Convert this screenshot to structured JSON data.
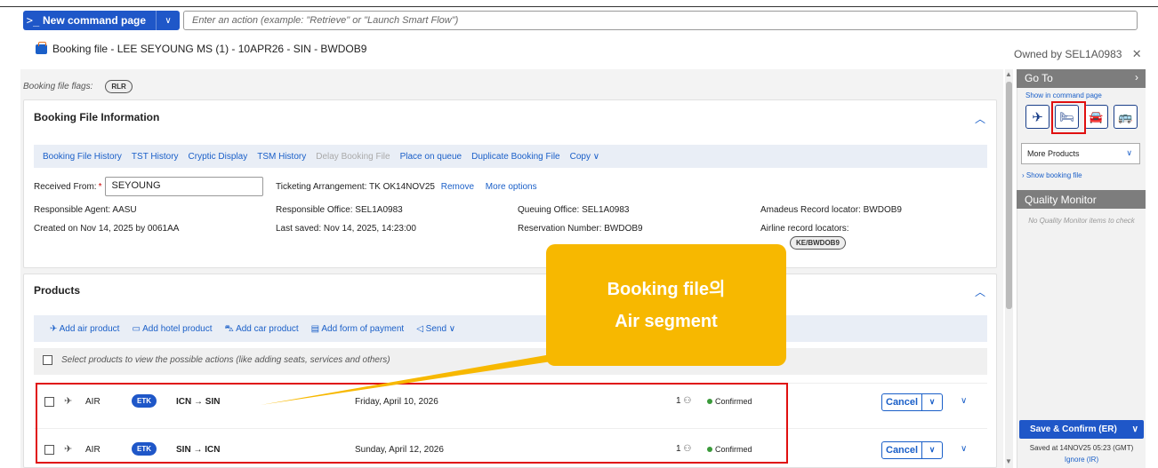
{
  "command_bar": {
    "prompt_glyph": ">_",
    "new_command_label": "New command page",
    "dropdown_glyph": "∨",
    "input_placeholder": "Enter an action (example: \"Retrieve\" or \"Launch Smart Flow\")"
  },
  "header": {
    "title": "Booking file - LEE SEYOUNG MS (1) - 10APR26 - SIN - BWDOB9",
    "owned_by": "Owned by SEL1A0983",
    "close_glyph": "✕"
  },
  "flags": {
    "label": "Booking file flags:",
    "badge": "RLR"
  },
  "booking_info": {
    "title": "Booking File Information",
    "toolbar": [
      {
        "label": "Booking File History",
        "enabled": true
      },
      {
        "label": "TST History",
        "enabled": true
      },
      {
        "label": "Cryptic Display",
        "enabled": true
      },
      {
        "label": "TSM History",
        "enabled": true
      },
      {
        "label": "Delay Booking File",
        "enabled": false
      },
      {
        "label": "Place on queue",
        "enabled": true
      },
      {
        "label": "Duplicate Booking File",
        "enabled": true
      },
      {
        "label": "Copy ∨",
        "enabled": true
      }
    ],
    "received_from_label": "Received From:",
    "received_from_required": "*",
    "received_from_value": "SEYOUNG",
    "ticketing_arrangement": "Ticketing Arrangement: TK OK14NOV25",
    "remove_label": "Remove",
    "more_options_label": "More options",
    "responsible_agent": "Responsible Agent: AASU",
    "responsible_office": "Responsible Office: SEL1A0983",
    "queuing_office": "Queuing Office: SEL1A0983",
    "amadeus_locator": "Amadeus Record locator: BWDOB9",
    "created_on": "Created on Nov 14, 2025 by 0061AA",
    "last_saved": "Last saved: Nov 14, 2025, 14:23:00",
    "reservation_number": "Reservation Number: BWDOB9",
    "airline_locators_label": "Airline record locators:",
    "airline_locator_badge": "KE/BWDOB9"
  },
  "products": {
    "title": "Products",
    "actions": [
      "Add air product",
      "Add hotel product",
      "Add car product",
      "Add form of payment",
      "Send ∨"
    ],
    "select_hint": "Select products to view the possible actions (like adding seats, services and others)",
    "segments": [
      {
        "type": "AIR",
        "badge": "ETK",
        "route": "ICN → SIN",
        "date": "Friday, April 10, 2026",
        "pax": "1",
        "status": "Confirmed",
        "cancel": "Cancel"
      },
      {
        "type": "AIR",
        "badge": "ETK",
        "route": "SIN → ICN",
        "date": "Sunday, April 12, 2026",
        "pax": "1",
        "status": "Confirmed",
        "cancel": "Cancel"
      }
    ]
  },
  "right_panel": {
    "goto_title": "Go To",
    "show_in_command_page": "Show in command page",
    "product_icons": [
      "plane-icon",
      "hotel-bed-icon",
      "car-icon",
      "transfer-icon"
    ],
    "more_products": "More Products",
    "show_booking_file": "› Show booking file",
    "quality_title": "Quality Monitor",
    "quality_empty": "No Quality Monitor items to check",
    "save_confirm": "Save & Confirm (ER)",
    "saved_at": "Saved at 14NOV25 05:23 (GMT)",
    "ignore": "Ignore (IR)"
  },
  "callout": {
    "line1": "Booking file의",
    "line2": "Air segment",
    "color": "#f7b800"
  },
  "colors": {
    "accent": "#1f57c8",
    "highlight_box": "#e01010",
    "status_confirmed": "#3a9a3a"
  }
}
